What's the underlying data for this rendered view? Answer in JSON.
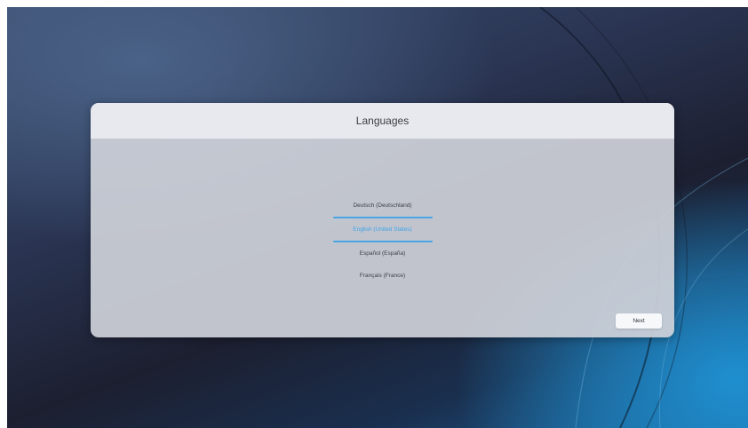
{
  "dialog": {
    "title": "Languages",
    "languages": [
      {
        "label": "Deutsch (Deutschland)",
        "selected": false
      },
      {
        "label": "English (United States)",
        "selected": true
      },
      {
        "label": "Español (España)",
        "selected": false
      },
      {
        "label": "Français (France)",
        "selected": false
      }
    ],
    "next_label": "Next"
  },
  "colors": {
    "accent": "#3da3e8",
    "dialog_bg": "#cdd1d8",
    "header_bg": "#e8eaef"
  }
}
